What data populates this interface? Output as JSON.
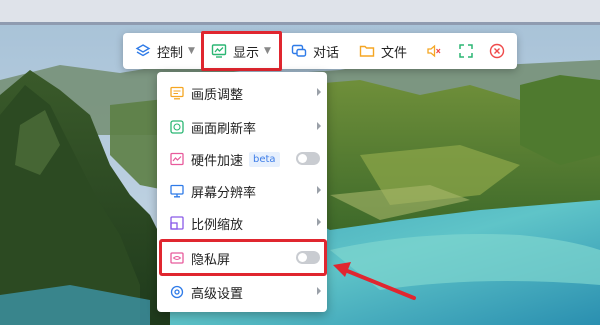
{
  "toolbar": {
    "items": [
      {
        "label": "控制",
        "icon": "layers-icon",
        "has_caret": true
      },
      {
        "label": "显示",
        "icon": "monitor-chart-icon",
        "has_caret": true
      },
      {
        "label": "对话",
        "icon": "chat-icon",
        "has_caret": false
      },
      {
        "label": "文件",
        "icon": "folder-icon",
        "has_caret": false
      },
      {
        "icon": "mute-speaker-icon"
      },
      {
        "icon": "fullscreen-icon"
      },
      {
        "icon": "close-circle-icon"
      }
    ]
  },
  "display_menu": {
    "items": [
      {
        "label": "画质调整",
        "icon": "picture-quality-icon",
        "type": "submenu"
      },
      {
        "label": "画面刷新率",
        "icon": "refresh-icon",
        "type": "submenu"
      },
      {
        "label": "硬件加速",
        "icon": "hardware-accel-icon",
        "type": "toggle",
        "badge": "beta",
        "on": false
      },
      {
        "label": "屏幕分辨率",
        "icon": "screen-resolution-icon",
        "type": "submenu"
      },
      {
        "label": "比例缩放",
        "icon": "scale-icon",
        "type": "submenu"
      },
      {
        "label": "隐私屏",
        "icon": "privacy-screen-icon",
        "type": "toggle",
        "on": false
      },
      {
        "label": "高级设置",
        "icon": "gear-icon",
        "type": "submenu"
      }
    ]
  },
  "colors": {
    "accent_orange": "#f5a623",
    "accent_green": "#2bb673",
    "accent_pink": "#e85a9c",
    "accent_blue": "#2f7be8",
    "accent_purple": "#8a5ae8",
    "close_red": "#ef4a4a",
    "highlight_red": "#e0262f",
    "toolbar_bg": "#ffffff"
  }
}
